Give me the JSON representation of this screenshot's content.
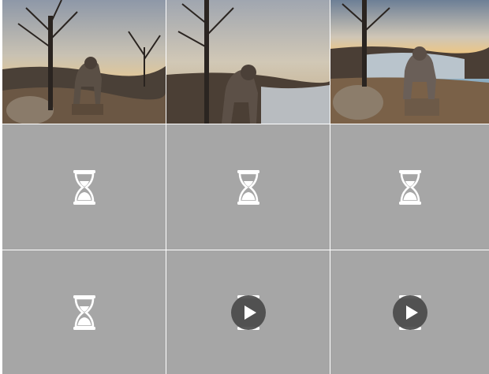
{
  "gallery": {
    "tiles": [
      {
        "kind": "photo",
        "scene": "dog-on-stump-left",
        "icon": "photo-thumbnail"
      },
      {
        "kind": "photo",
        "scene": "dog-closeup-center",
        "icon": "photo-thumbnail"
      },
      {
        "kind": "photo",
        "scene": "dog-on-stump-front",
        "icon": "photo-thumbnail"
      },
      {
        "kind": "loading",
        "icon": "hourglass-icon"
      },
      {
        "kind": "loading",
        "icon": "hourglass-icon"
      },
      {
        "kind": "loading",
        "icon": "hourglass-icon"
      },
      {
        "kind": "loading",
        "icon": "hourglass-icon"
      },
      {
        "kind": "video-loading",
        "icon": "play-icon"
      },
      {
        "kind": "video-loading",
        "icon": "play-icon"
      }
    ],
    "colors": {
      "placeholder": "#a6a6a6",
      "hourglass": "#ffffff",
      "play_button": "#4a4a4a"
    }
  }
}
